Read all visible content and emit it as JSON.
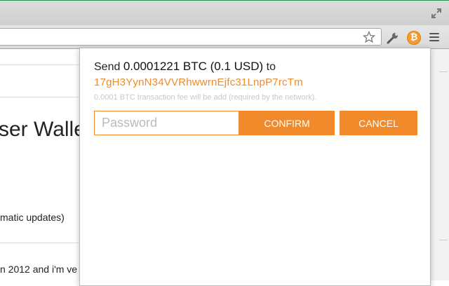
{
  "browser": {
    "bitcoin_glyph": "₿",
    "icons": [
      "fullscreen-icon",
      "star-icon",
      "wrench-icon",
      "bitcoin-extension-icon",
      "menu-icon"
    ]
  },
  "page": {
    "heading_fragment": "ser Walle",
    "text_line_1": "matic updates)",
    "text_line_2": "n 2012 and i'm ve"
  },
  "popup": {
    "send_prefix": "Send",
    "amount": "0.0001221 BTC (0.1 USD)",
    "to_label": "to",
    "address": "17gH3YynN34VVRhwwrnEjfc31LnpP7rcTm",
    "fee_note": "0.0001 BTC transaction fee will be add (required by the network).",
    "password_placeholder": "Password",
    "confirm_label": "CONFIRM",
    "cancel_label": "CANCEL"
  },
  "colors": {
    "accent": "#f08a2a",
    "bitcoin": "#f29c2b",
    "fee_text": "#c8c8c8"
  }
}
